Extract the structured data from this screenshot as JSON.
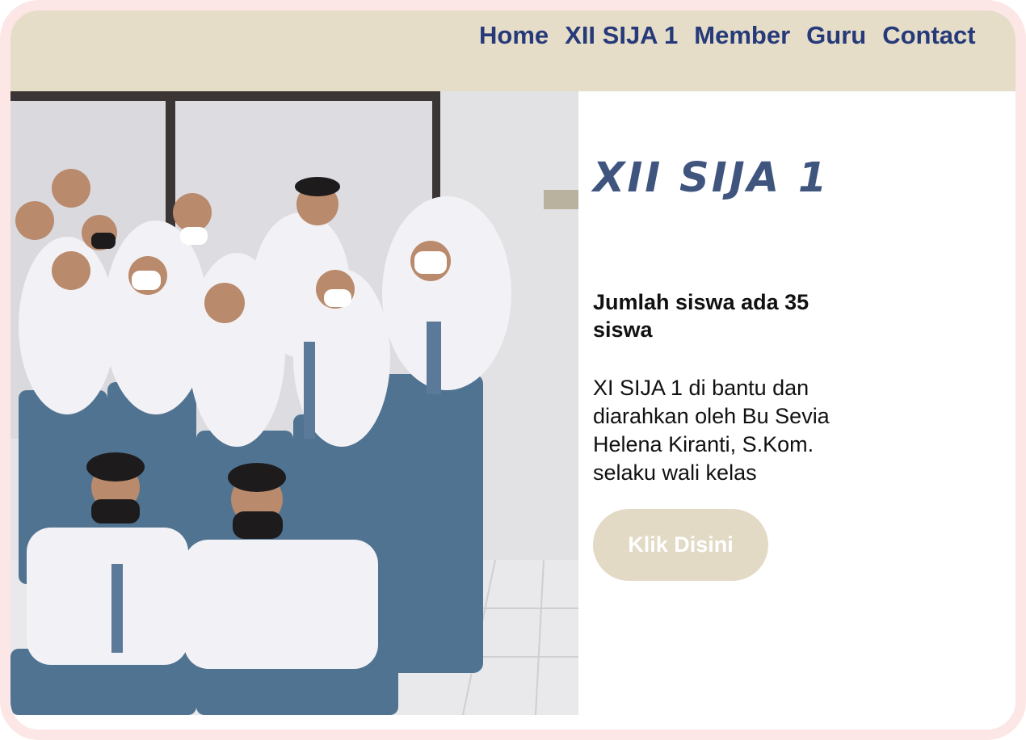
{
  "nav": {
    "items": [
      {
        "label": "Home"
      },
      {
        "label": "XII SIJA 1"
      },
      {
        "label": "Member"
      },
      {
        "label": "Guru"
      },
      {
        "label": "Contact"
      }
    ]
  },
  "hero": {
    "title": "XII SIJA 1",
    "count_text": "Jumlah siswa ada 35 siswa",
    "description": "XI SIJA 1 di bantu dan diarahkan oleh Bu Sevia Helena Kiranti, S.Kom. selaku wali kelas",
    "button_label": "Klik Disini"
  },
  "colors": {
    "navbar_bg": "#e5ddc8",
    "nav_text": "#263a7a",
    "title_text": "#3f557e",
    "button_bg": "#e3dac6",
    "frame_border": "#fde6e6"
  }
}
